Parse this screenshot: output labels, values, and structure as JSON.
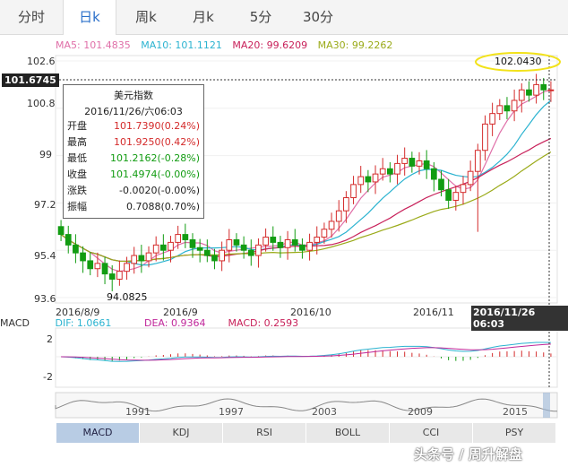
{
  "tabs": [
    {
      "label": "分时",
      "active": false
    },
    {
      "label": "日k",
      "active": true
    },
    {
      "label": "周k",
      "active": false
    },
    {
      "label": "月k",
      "active": false
    },
    {
      "label": "5分",
      "active": false
    },
    {
      "label": "30分",
      "active": false
    }
  ],
  "ma_legend": [
    {
      "text": "MA5: 101.4835",
      "color": "#e06fa8"
    },
    {
      "text": "MA10: 101.1121",
      "color": "#2bb3d0"
    },
    {
      "text": "MA20: 99.6209",
      "color": "#c8215a"
    },
    {
      "text": "MA30: 99.2262",
      "color": "#9aaa18"
    }
  ],
  "price_axis": [
    "102.6",
    "100.8",
    "99",
    "97.2",
    "95.4",
    "93.6"
  ],
  "highlight_price": "101.6745",
  "max_label": "102.0430",
  "min_label": "94.0825",
  "x_labels": [
    "2016/8/9",
    "2016/9",
    "2016/10",
    "2016/11"
  ],
  "cursor_date": "2016/11/26 06:03",
  "tooltip": {
    "title": "美元指数",
    "date": "2016/11/26/六06:03",
    "rows": [
      {
        "key": "开盘",
        "value": "101.7390(0.24%)",
        "tone": "red"
      },
      {
        "key": "最高",
        "value": "101.9250(0.42%)",
        "tone": "red"
      },
      {
        "key": "最低",
        "value": "101.2162(-0.28%)",
        "tone": "green"
      },
      {
        "key": "收盘",
        "value": "101.4974(-0.00%)",
        "tone": "green"
      },
      {
        "key": "涨跌",
        "value": "-0.0020(-0.00%)",
        "tone": "plain"
      },
      {
        "key": "振幅",
        "value": "0.7088(0.70%)",
        "tone": "plain"
      }
    ]
  },
  "macd_legend": {
    "title": "MACD",
    "dif": "DIF: 1.0661",
    "dea": "DEA: 0.9364",
    "macd": "MACD: 0.2593"
  },
  "macd_axis": [
    "2",
    "-2"
  ],
  "timeline_years": [
    "1991",
    "1997",
    "2003",
    "2009",
    "2015"
  ],
  "indicator_tabs": [
    {
      "label": "MACD",
      "active": true
    },
    {
      "label": "KDJ",
      "active": false
    },
    {
      "label": "RSI",
      "active": false
    },
    {
      "label": "BOLL",
      "active": false
    },
    {
      "label": "CCI",
      "active": false
    },
    {
      "label": "PSY",
      "active": false
    }
  ],
  "watermark": "头条号 / 周升解盘",
  "chart_data": {
    "type": "candlestick",
    "title": "美元指数",
    "y_range": [
      93.6,
      102.6
    ],
    "candles_close": [
      96.0,
      95.6,
      95.3,
      95.0,
      94.7,
      94.9,
      94.5,
      94.3,
      94.6,
      94.9,
      95.2,
      95.0,
      95.3,
      95.6,
      95.4,
      95.7,
      96.0,
      95.8,
      95.5,
      95.4,
      95.2,
      95.0,
      95.4,
      95.8,
      95.6,
      95.4,
      95.2,
      95.6,
      95.9,
      95.7,
      95.5,
      95.8,
      95.6,
      95.4,
      95.7,
      95.9,
      96.2,
      96.5,
      96.9,
      97.4,
      97.9,
      98.2,
      98.0,
      98.3,
      98.5,
      98.3,
      98.7,
      98.9,
      98.6,
      98.8,
      98.5,
      98.1,
      97.7,
      97.3,
      97.6,
      97.9,
      98.4,
      99.2,
      100.2,
      100.6,
      100.9,
      100.7,
      101.1,
      101.5,
      101.3,
      101.7,
      101.5,
      101.5
    ],
    "macd_dif_end": 1.0661,
    "macd_dea_end": 0.9364,
    "macd_hist_end": 0.2593
  }
}
